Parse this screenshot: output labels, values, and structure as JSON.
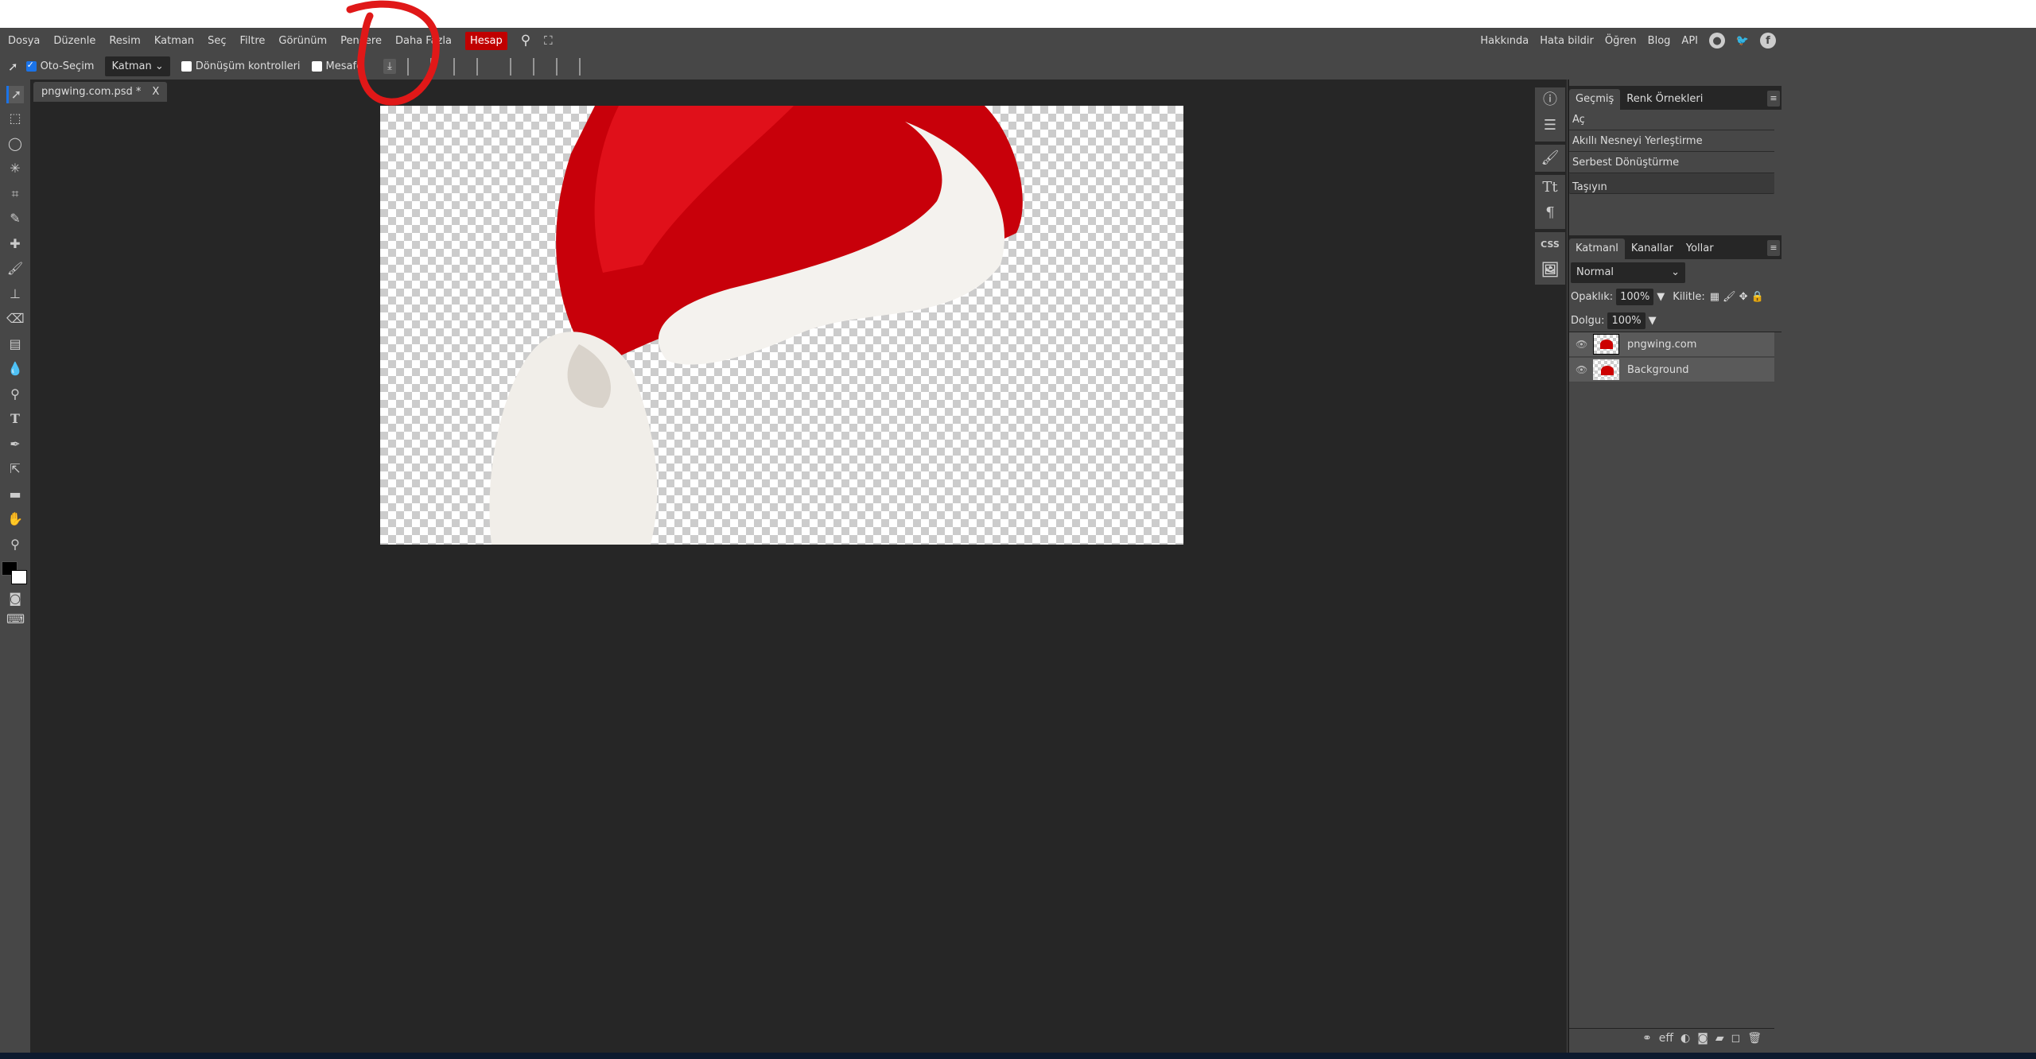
{
  "menu": {
    "items": [
      "Dosya",
      "Düzenle",
      "Resim",
      "Katman",
      "Seç",
      "Filtre",
      "Görünüm",
      "Pencere",
      "Daha Fazla"
    ],
    "account": "Hesap",
    "right": [
      "Hakkında",
      "Hata bildir",
      "Öğren",
      "Blog",
      "API"
    ],
    "accent": "#c00000"
  },
  "toolbar": {
    "auto_select": "Oto-Seçim",
    "auto_select_checked": true,
    "target": "Katman",
    "transform_controls": "Dönüşüm kontrolleri",
    "distances": "Mesafe"
  },
  "document": {
    "tab": "pngwing.com.psd *",
    "close": "X"
  },
  "history": {
    "tabs": [
      "Geçmiş",
      "Renk Örnekleri"
    ],
    "items": [
      "Aç",
      "Akıllı Nesneyi Yerleştirme",
      "Serbest Dönüştürme",
      "Taşıyın"
    ],
    "selected": "Taşıyın"
  },
  "layers": {
    "tabs": [
      "Katmanl",
      "Kanallar",
      "Yollar"
    ],
    "blend": "Normal",
    "opacity_label": "Opaklık:",
    "opacity": "100%",
    "lock_label": "Kilitle:",
    "fill_label": "Dolgu:",
    "fill": "100%",
    "items": [
      "pngwing.com",
      "Background"
    ]
  },
  "iconbar": {
    "css": "CSS"
  }
}
